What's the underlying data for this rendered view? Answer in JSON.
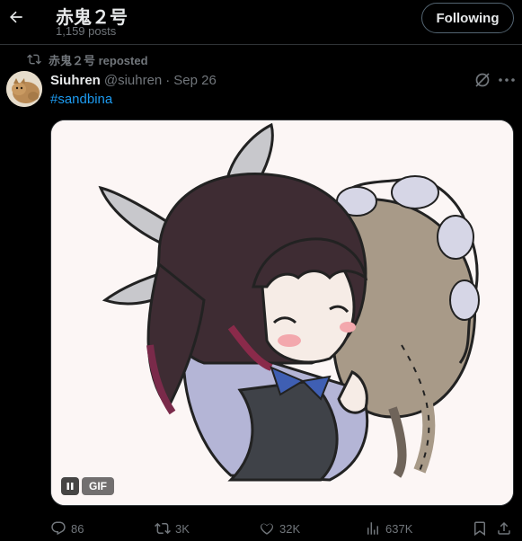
{
  "header": {
    "back_icon": "arrow-left-icon",
    "profile_name": "赤鬼２号",
    "post_count": "1,159 posts",
    "follow_label": "Following"
  },
  "repost": {
    "icon": "repost-icon",
    "text": "赤鬼２号 reposted"
  },
  "post": {
    "author_name": "Siuhren",
    "author_handle": "@siuhren",
    "separator": "·",
    "date": "Sep 26",
    "hashtag": "#sandbina",
    "media": {
      "type": "GIF",
      "badge": "GIF",
      "pause_icon": "pause-icon",
      "background": "#fcf6f5"
    }
  },
  "actions": {
    "replies": "86",
    "reposts": "3K",
    "likes": "32K",
    "views": "637K"
  },
  "colors": {
    "background": "#000000",
    "text": "#e7e9ea",
    "muted": "#71767b",
    "link": "#1d9bf0",
    "border": "#2f3336"
  }
}
